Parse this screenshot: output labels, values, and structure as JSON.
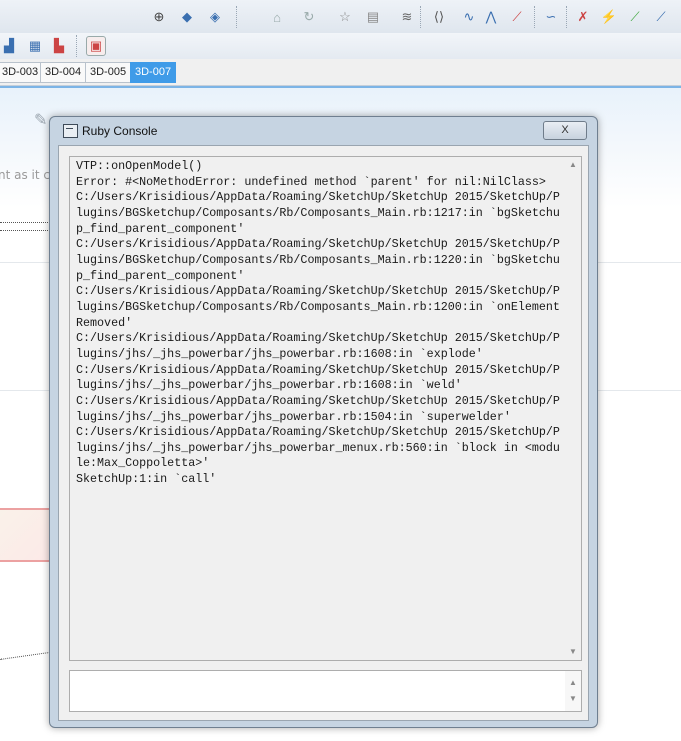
{
  "toolbar": {
    "icons": [
      "orbit-icon",
      "view-iso-icon",
      "view-top-icon",
      "home-icon",
      "star-icon",
      "clipboard-icon",
      "layers-icon",
      "edge-style-icon",
      "dashed-line-icon",
      "wave-icon",
      "soften-icon",
      "eye-icon",
      "curve-icon",
      "intersect-icon",
      "unknown-icon"
    ]
  },
  "scene_tabs": [
    "3D-003",
    "3D-004",
    "3D-005",
    "3D-007"
  ],
  "active_tab": "3D-007",
  "background_text": "nt as it cr",
  "console": {
    "title": "Ruby Console",
    "close_label": "X",
    "output_lines": [
      "VTP::onOpenModel()",
      "Error: #<NoMethodError: undefined method `parent' for nil:NilClass>",
      "C:/Users/Krisidious/AppData/Roaming/SketchUp/SketchUp 2015/SketchUp/Plugins/BGSketchup/Composants/Rb/Composants_Main.rb:1217:in `bgSketchup_find_parent_component'",
      "C:/Users/Krisidious/AppData/Roaming/SketchUp/SketchUp 2015/SketchUp/Plugins/BGSketchup/Composants/Rb/Composants_Main.rb:1220:in `bgSketchup_find_parent_component'",
      "C:/Users/Krisidious/AppData/Roaming/SketchUp/SketchUp 2015/SketchUp/Plugins/BGSketchup/Composants/Rb/Composants_Main.rb:1200:in `onElementRemoved'",
      "C:/Users/Krisidious/AppData/Roaming/SketchUp/SketchUp 2015/SketchUp/Plugins/jhs/_jhs_powerbar/jhs_powerbar.rb:1608:in `explode'",
      "C:/Users/Krisidious/AppData/Roaming/SketchUp/SketchUp 2015/SketchUp/Plugins/jhs/_jhs_powerbar/jhs_powerbar.rb:1608:in `weld'",
      "C:/Users/Krisidious/AppData/Roaming/SketchUp/SketchUp 2015/SketchUp/Plugins/jhs/_jhs_powerbar/jhs_powerbar.rb:1504:in `superwelder'",
      "C:/Users/Krisidious/AppData/Roaming/SketchUp/SketchUp 2015/SketchUp/Plugins/jhs/_jhs_powerbar/jhs_powerbar_menux.rb:560:in `block in <module:Max_Coppoletta>'",
      "SketchUp:1:in `call'"
    ],
    "input_value": ""
  }
}
